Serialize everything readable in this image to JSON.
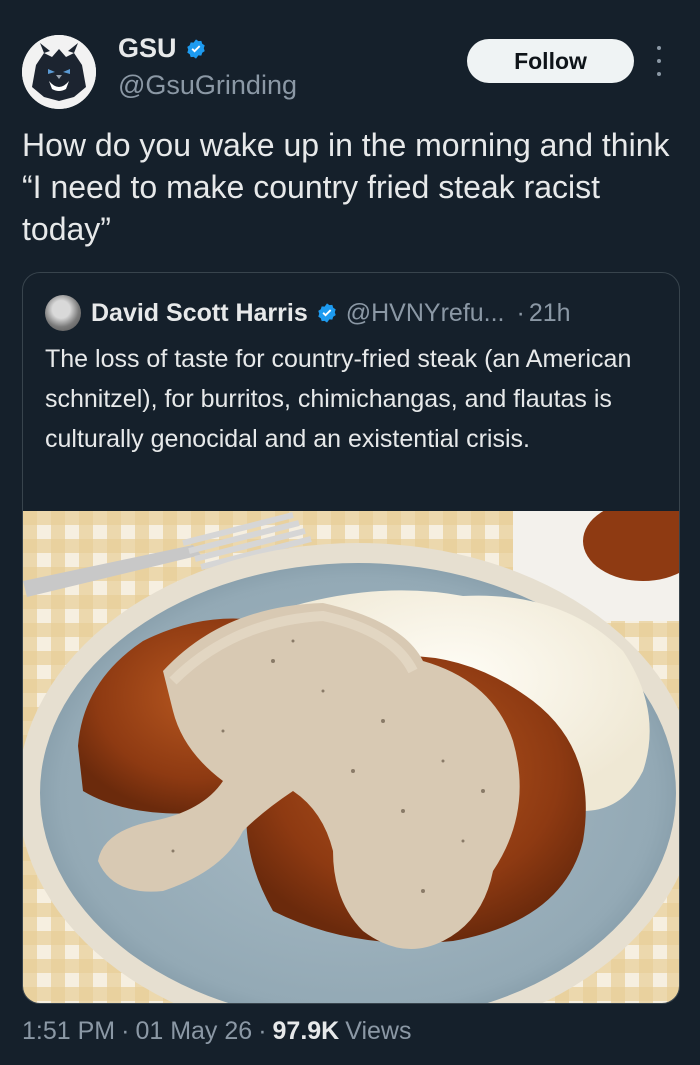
{
  "author": {
    "name": "GSU",
    "handle": "@GsuGrinding",
    "verified": true,
    "avatar_icon": "panther-mascot-icon"
  },
  "follow_label": "Follow",
  "tweet_text": "How do you wake up in the morning and think “I need to make country fried steak racist today”",
  "quoted": {
    "name": "David Scott Harris",
    "handle": "@HVNYrefu...",
    "separator": "·",
    "time": "21h",
    "text": "The loss of taste for country-fried steak (an American schnitzel), for burritos, chimichangas, and flautas is culturally genocidal and an existential crisis.",
    "image_subject": "country fried steak with gravy and mashed potatoes"
  },
  "meta": {
    "time": "1:51 PM",
    "sep1": "·",
    "date": "01 May 26",
    "sep2": "·",
    "views": "97.9K",
    "views_label": "Views"
  },
  "colors": {
    "background": "#15202b",
    "verified_blue": "#1d9bf0",
    "secondary_text": "#8b98a5"
  }
}
